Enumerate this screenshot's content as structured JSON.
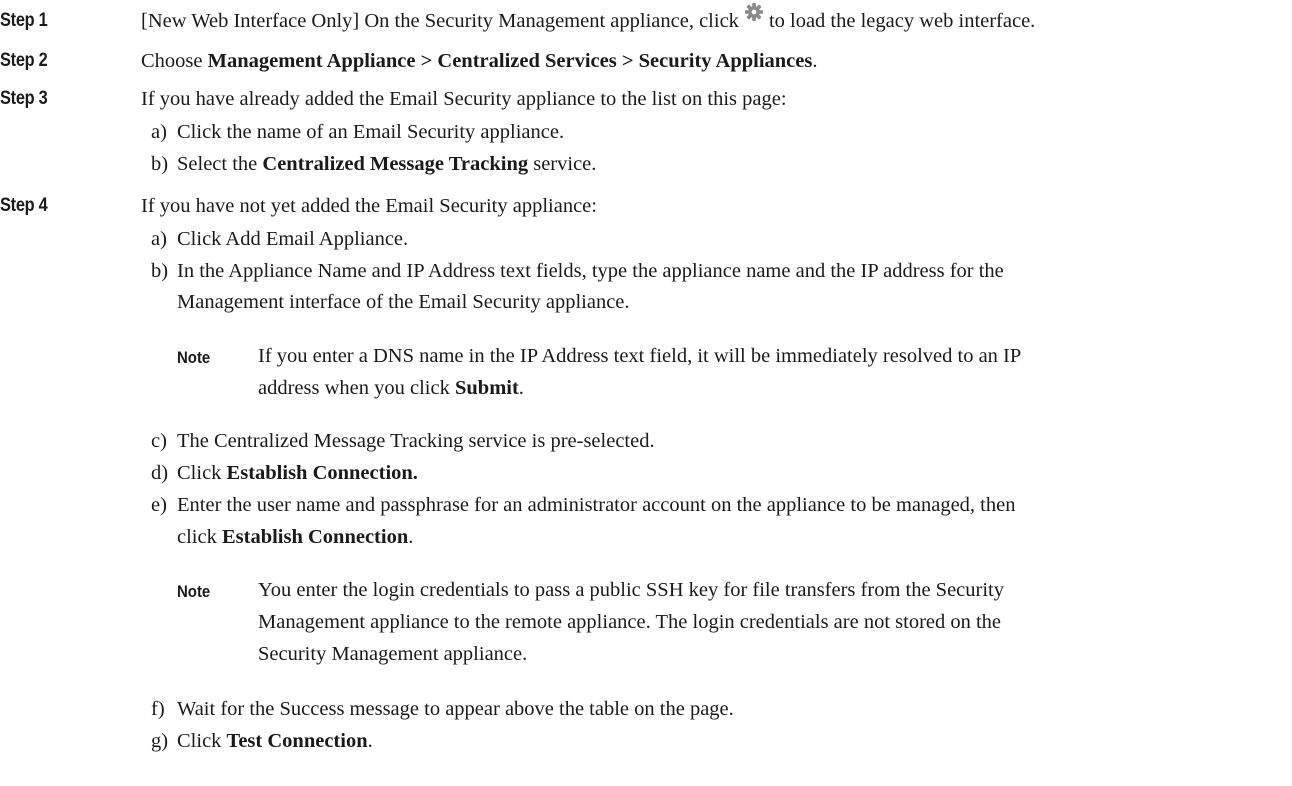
{
  "steps": [
    {
      "label": "Step 1",
      "text_a": "[New Web Interface Only] On the Security Management appliance, click",
      "icon": "gear-icon",
      "text_b": "to load the legacy web interface."
    },
    {
      "label": "Step 2",
      "prefix": "Choose ",
      "bold": "Management Appliance > Centralized Services > Security Appliances",
      "suffix": "."
    },
    {
      "label": "Step 3",
      "text": "If you have already added the Email Security appliance to the list on this page:",
      "substeps": [
        {
          "marker": "a)",
          "text": "Click the name of an Email Security appliance."
        },
        {
          "marker": "b)",
          "prefix": "Select the ",
          "bold": "Centralized Message Tracking",
          "suffix": " service."
        }
      ]
    },
    {
      "label": "Step 4",
      "text": "If you have not yet added the Email Security appliance:",
      "substeps": [
        {
          "marker": "a)",
          "text": "Click Add Email Appliance."
        },
        {
          "marker": "b)",
          "line1": "In the Appliance Name and IP Address text fields, type the appliance name and the IP address for the",
          "line2": "Management interface of the Email Security appliance.",
          "note": {
            "label": "Note",
            "line1": "If you enter a DNS name in the IP Address text field, it will be immediately resolved to an IP",
            "line2_prefix": "address when you click ",
            "line2_bold": "Submit",
            "line2_suffix": "."
          }
        },
        {
          "marker": "c)",
          "text": "The Centralized Message Tracking service is pre-selected."
        },
        {
          "marker": "d)",
          "prefix": "Click ",
          "bold": "Establish Connection."
        },
        {
          "marker": "e)",
          "line1": "Enter the user name and passphrase for an administrator account on the appliance to be managed, then",
          "line2_prefix": "click ",
          "line2_bold": "Establish Connection",
          "line2_suffix": ".",
          "note": {
            "label": "Note",
            "line1": "You enter the login credentials to pass a public SSH key for file transfers from the Security",
            "line2": "Management appliance to the remote appliance. The login credentials are not stored on the",
            "line3": "Security Management appliance."
          }
        },
        {
          "marker": "f)",
          "text": "Wait for the Success message to appear above the table on the page."
        },
        {
          "marker": "g)",
          "prefix": "Click ",
          "bold": "Test Connection",
          "suffix": "."
        }
      ]
    }
  ],
  "colors": {
    "text": "#1a1a1a",
    "icon": "#8a8a8a"
  }
}
